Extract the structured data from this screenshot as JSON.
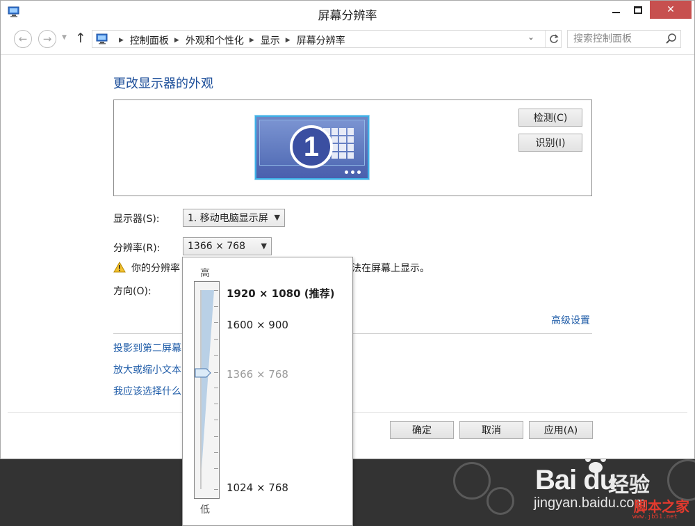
{
  "window": {
    "title": "屏幕分辨率",
    "controls": {
      "minimize": "minimize",
      "maximize": "maximize",
      "close": "✕"
    }
  },
  "nav": {
    "breadcrumbs": [
      "控制面板",
      "外观和个性化",
      "显示",
      "屏幕分辨率"
    ],
    "search_placeholder": "搜索控制面板"
  },
  "main": {
    "heading": "更改显示器的外观",
    "monitor_number": "1",
    "detect_button": "检测(C)",
    "identify_button": "识别(I)",
    "display_label": "显示器(S):",
    "display_value": "1. 移动电脑显示屏",
    "resolution_label": "分辨率(R):",
    "resolution_value": "1366 × 768",
    "warning_text_a": "你的分辨率",
    "warning_text_b": "法在屏幕上显示。",
    "orientation_label": "方向(O):",
    "advanced_link": "高级设置",
    "links": [
      "投影到第二屏幕",
      "放大或缩小文本",
      "我应该选择什么"
    ]
  },
  "footer": {
    "ok": "确定",
    "cancel": "取消",
    "apply": "应用(A)"
  },
  "resolution_popup": {
    "high_label": "高",
    "low_label": "低",
    "options": [
      {
        "label": "1920 × 1080 (推荐)",
        "recommended": true
      },
      {
        "label": "1600 × 900"
      },
      {
        "label": "1366 × 768",
        "current": true
      },
      {
        "label": "1024 × 768"
      }
    ],
    "slider_level": 0.39
  },
  "watermark": {
    "logo": "Bai du",
    "cn": "经验",
    "url": "jingyan.baidu.com",
    "site_cn": "脚本之家",
    "site_url": "www.jb51.net"
  },
  "colors": {
    "link": "#1f5ca8",
    "heading": "#1d4f9a",
    "close_button": "#c7504f",
    "slider_fill": "#b9d0e6",
    "watermark_red": "#e23a2e"
  },
  "icons": {
    "title": "control-panel-monitor-icon",
    "warning": "warning-icon",
    "search": "search-icon",
    "refresh": "refresh-icon"
  }
}
